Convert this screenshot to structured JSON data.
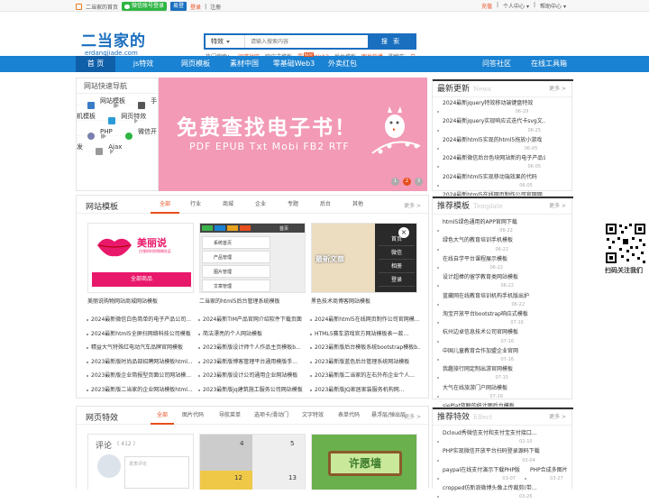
{
  "topbar": {
    "home": "二当家的首页",
    "wechat_login": "微信账号登录",
    "ye": "易登",
    "login": "登录",
    "register": "注册",
    "recharge": "充值",
    "user_center": "个人中心",
    "help_center": "帮助中心"
  },
  "header": {
    "logo": "二当家的",
    "logo_sub": "erdangjiade.com",
    "search_type": "特效",
    "search_placeholder": "请输入搜索内容",
    "search_btn": "搜 索",
    "hot_label": "热门搜索：",
    "hot": [
      "间谍社区",
      "响应式模板",
      "零基础Web3",
      "后台模板",
      "图片轮播",
      "购物车",
      "自"
    ]
  },
  "nav": {
    "items": [
      "首 页",
      "js特效",
      "网页模板",
      "素材中国",
      "零基础Web3",
      "外卖红包"
    ],
    "badge": "NEW",
    "right": [
      "问答社区",
      "在线工具箱"
    ]
  },
  "quick": {
    "title": "网站快速导航",
    "items": [
      "网站模板",
      "手机模板",
      "网页特效",
      "PHP",
      "微信开发",
      "Ajax"
    ]
  },
  "banner": {
    "title": "免费查找电子书！",
    "subtitle": "PDF EPUB Txt Mobi FB2 RTF",
    "dots": [
      "1",
      "2",
      "3"
    ]
  },
  "latest": {
    "title": "最新更新",
    "en": "News",
    "more": "更多 >",
    "rows": [
      [
        "2024最新jquery特效移动端键盘特效",
        "06-29"
      ],
      [
        "2024最新jquery实现响应式迭代卡svg文...",
        "06-25"
      ],
      [
        "2024最新html5实现的html5拖放小游戏",
        "06-05"
      ],
      [
        "2024最新微信后台色块网站新的电子产品公司...",
        "06-05"
      ],
      [
        "2024最新html5实现移动端效果的代码",
        "06-05"
      ],
      [
        "2024最新html5在线网页制作公司官网网...",
        "06-05"
      ],
      [
        "2024最新TIM产品官网介绍软件下载页面",
        "06-05"
      ],
      [
        "2024最新jQuery全屏手风琴四季场景变...",
        "06-05"
      ]
    ]
  },
  "templates": {
    "title": "网站模板",
    "tabs": [
      "全部",
      "行业",
      "商城",
      "企业",
      "专题",
      "后台",
      "其他"
    ],
    "more": "更多 >",
    "thumb1": {
      "brand": "美丽说",
      "brand_sub": "白领的时尚购物社区",
      "btn": "全部商品"
    },
    "thumb2": {
      "menus": [
        "系统首页",
        "产品管理",
        "图片管理",
        "文章管理"
      ],
      "tab": "首页"
    },
    "thumb3": {
      "overlay": "最新文章",
      "menu": [
        "首页",
        "微信",
        "相册",
        "登录"
      ]
    },
    "captions": [
      "美丽说购物网站商城网站模板",
      "二当家的html5后台管理系统模板",
      "黑色技术商博客网站模板"
    ],
    "list": [
      [
        "2024最新微信白色简单的电子产品公司...",
        "2024最新TIM产品官网介绍软件下载页面",
        "2024最新html5在线网页制作公司官网模..."
      ],
      [
        "2024最新html5全屏扫网络科技公司模板",
        "简洁漂亮的个人网站模板",
        "HTML5赛车游戏官方网站模板表一款..."
      ],
      [
        "精益大气特殊红电动汽车品牌官网模板",
        "2023最新版设计师个人作品主页模板b...",
        "2023最新版后台模板系统bootstrap模板b..."
      ],
      [
        "2023最新版时尚品部招聘网站模板html...",
        "2023最新版博客管理平台通用模版手...",
        "2023最新版蓝色后台管理系统网站模板"
      ],
      [
        "2023最新版企业简报型页面公司网站模...",
        "2023最新版设计公司通用企业网站模板",
        "2023最新版二当家的左右外布企业个人..."
      ],
      [
        "2023最新版二当家的企业网站模板html...",
        "2023最新版jq建筑施工服务公司网站模板",
        "2023最新版JQ家居家装服务机构网..."
      ]
    ]
  },
  "recommend": {
    "title": "推荐模板",
    "en": "Template",
    "more": "更多 >",
    "rows": [
      [
        "html5绿色通用的APP官网下载",
        "06-22"
      ],
      [
        "绿色大气的教育培训手机模板",
        "06-22"
      ],
      [
        "在线自学平台课程展示模板",
        "06-22"
      ],
      [
        "设计超棒的留学教育类网站模板",
        "06-22"
      ],
      [
        "蓝藏网在线教育培训机构手机版出护",
        "06-22"
      ],
      [
        "淘宝开放平台bootstrap响应式模板",
        "07-16"
      ],
      [
        "杭州边卓信息技术公司官网模板",
        "07-16"
      ],
      [
        "中国儿童教育合作加盟企业官网",
        "07-16"
      ],
      [
        "我趣旅行网定制出游官网模板",
        "07-15"
      ],
      [
        "大气在线旅游门户网站模板",
        "07-16"
      ],
      [
        "sjePlat蓝鲸的统计图后台模板",
        "07-16"
      ],
      [
        "超美的刑律咨询行业后台管网模板",
        "07-08"
      ],
      [
        "上海嘱嘱里装修行业加盟店模板下载",
        "07-08"
      ],
      [
        "今较人力资源人事中管官网模板",
        "07-06"
      ]
    ]
  },
  "effects": {
    "title": "网页特效",
    "tabs": [
      "全部",
      "图片代码",
      "导航菜单",
      "选项卡/滑动门",
      "文字特效",
      "表单代码",
      "悬浮层/弹出层"
    ],
    "more": "更多 >",
    "comment": "评论",
    "comment_count": "( 412 )",
    "comment_placeholder": "发表评论",
    "nums": [
      "4",
      "5",
      "12",
      "13"
    ],
    "wish": "许愿墙"
  },
  "recommend_effects": {
    "title": "推荐特效",
    "en": "Effect",
    "more": "更多 >",
    "rows": [
      [
        "Dcloud秀微信支付和支付宝支付接口...",
        "02-10"
      ],
      [
        "PHP实现微信开放平台扫码登录源码下载",
        "03-04"
      ],
      [
        "paypal在线支付演示下载PHP版",
        "03-07"
      ],
      [
        "PHP合成多图片",
        "03-27"
      ],
      [
        "cropped仿新浪微博头像上传裁剪(带...",
        "03-26"
      ]
    ]
  },
  "qr": {
    "caption": "扫码关注我们"
  },
  "colors": {
    "primary": "#1a82d2",
    "accent": "#e84e1e",
    "banner": "#f29ab6"
  }
}
